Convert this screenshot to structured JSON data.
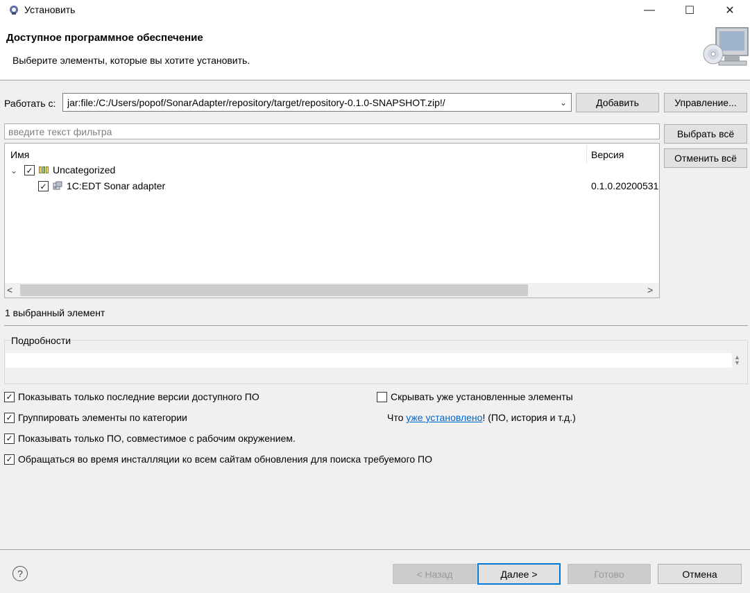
{
  "window": {
    "title": "Установить",
    "min_glyph": "—",
    "max_glyph": "☐",
    "close_glyph": "✕"
  },
  "header": {
    "heading": "Доступное программное обеспечение",
    "description": "Выберите элементы, которые вы хотите установить."
  },
  "work_with": {
    "label": "Работать с:",
    "value": "jar:file:/C:/Users/popof/SonarAdapter/repository/target/repository-0.1.0-SNAPSHOT.zip!/",
    "add_label": "Добавить",
    "manage_label": "Управление..."
  },
  "filter": {
    "placeholder": "введите текст фильтра",
    "select_all_label": "Выбрать всё",
    "deselect_all_label": "Отменить всё"
  },
  "tree": {
    "columns": [
      "Имя",
      "Версия"
    ],
    "category": {
      "label": "Uncategorized",
      "checked": true,
      "expanded": true
    },
    "items": [
      {
        "label": "1C:EDT Sonar adapter",
        "version": "0.1.0.20200531",
        "checked": true
      }
    ],
    "scroll_left_glyph": "<",
    "scroll_right_glyph": ">"
  },
  "selection_status": "1 выбранный элемент",
  "details": {
    "label": "Подробности",
    "text": ""
  },
  "options": {
    "latest_versions": {
      "label": "Показывать только последние версии доступного ПО",
      "checked": true
    },
    "group_by_category": {
      "label": "Группировать элементы по категории",
      "checked": true
    },
    "compatible_only": {
      "label": "Показывать только ПО, совместимое с рабочим окружением.",
      "checked": true
    },
    "contact_all_sites": {
      "label": "Обращаться во время инсталляции ко всем сайтам обновления для поиска требуемого ПО",
      "checked": true
    },
    "hide_installed": {
      "label": "Скрывать уже установленные элементы",
      "checked": false
    }
  },
  "installed_info": {
    "prefix": "Что ",
    "link": "уже установлено",
    "suffix": "! (ПО, история и т.д.)"
  },
  "footer": {
    "help_glyph": "?",
    "back_label": "< Назад",
    "next_label": "Далее >",
    "finish_label": "Готово",
    "cancel_label": "Отмена"
  },
  "colors": {
    "accent": "#0078d7",
    "link": "#0066cc"
  }
}
